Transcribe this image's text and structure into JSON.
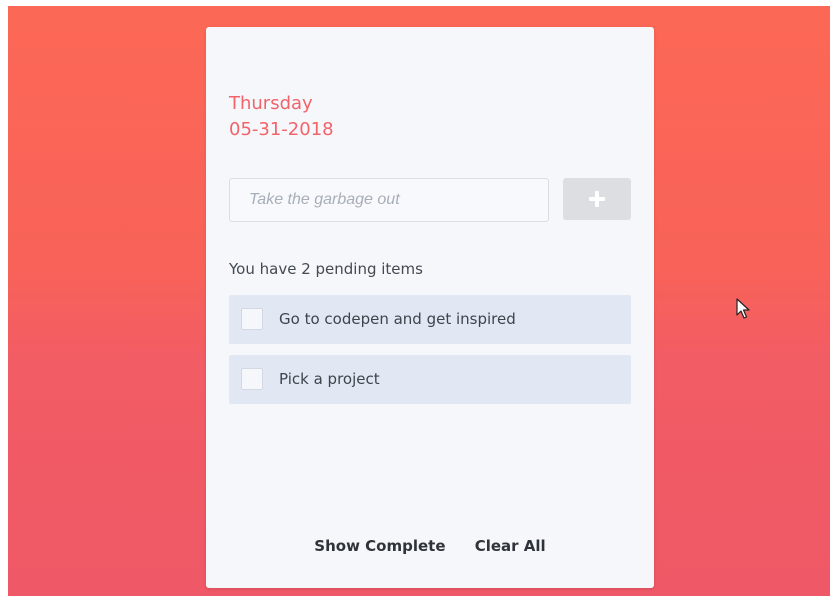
{
  "header": {
    "day": "Thursday",
    "date": "05-31-2018"
  },
  "task_input": {
    "value": "",
    "placeholder": "Take the garbage out"
  },
  "add_button": {
    "icon": "plus-icon"
  },
  "status": {
    "pending_text": "You have 2 pending items"
  },
  "todos": [
    {
      "label": "Go to codepen and get inspired",
      "checked": false
    },
    {
      "label": "Pick a project",
      "checked": false
    }
  ],
  "footer": {
    "show_complete_label": "Show Complete",
    "clear_all_label": "Clear All"
  },
  "colors": {
    "accent": "#f2636a",
    "background_top": "#fc6856",
    "background_bottom": "#ef5866",
    "card": "#f5f7fb",
    "todo_item": "#e1e8f4"
  }
}
